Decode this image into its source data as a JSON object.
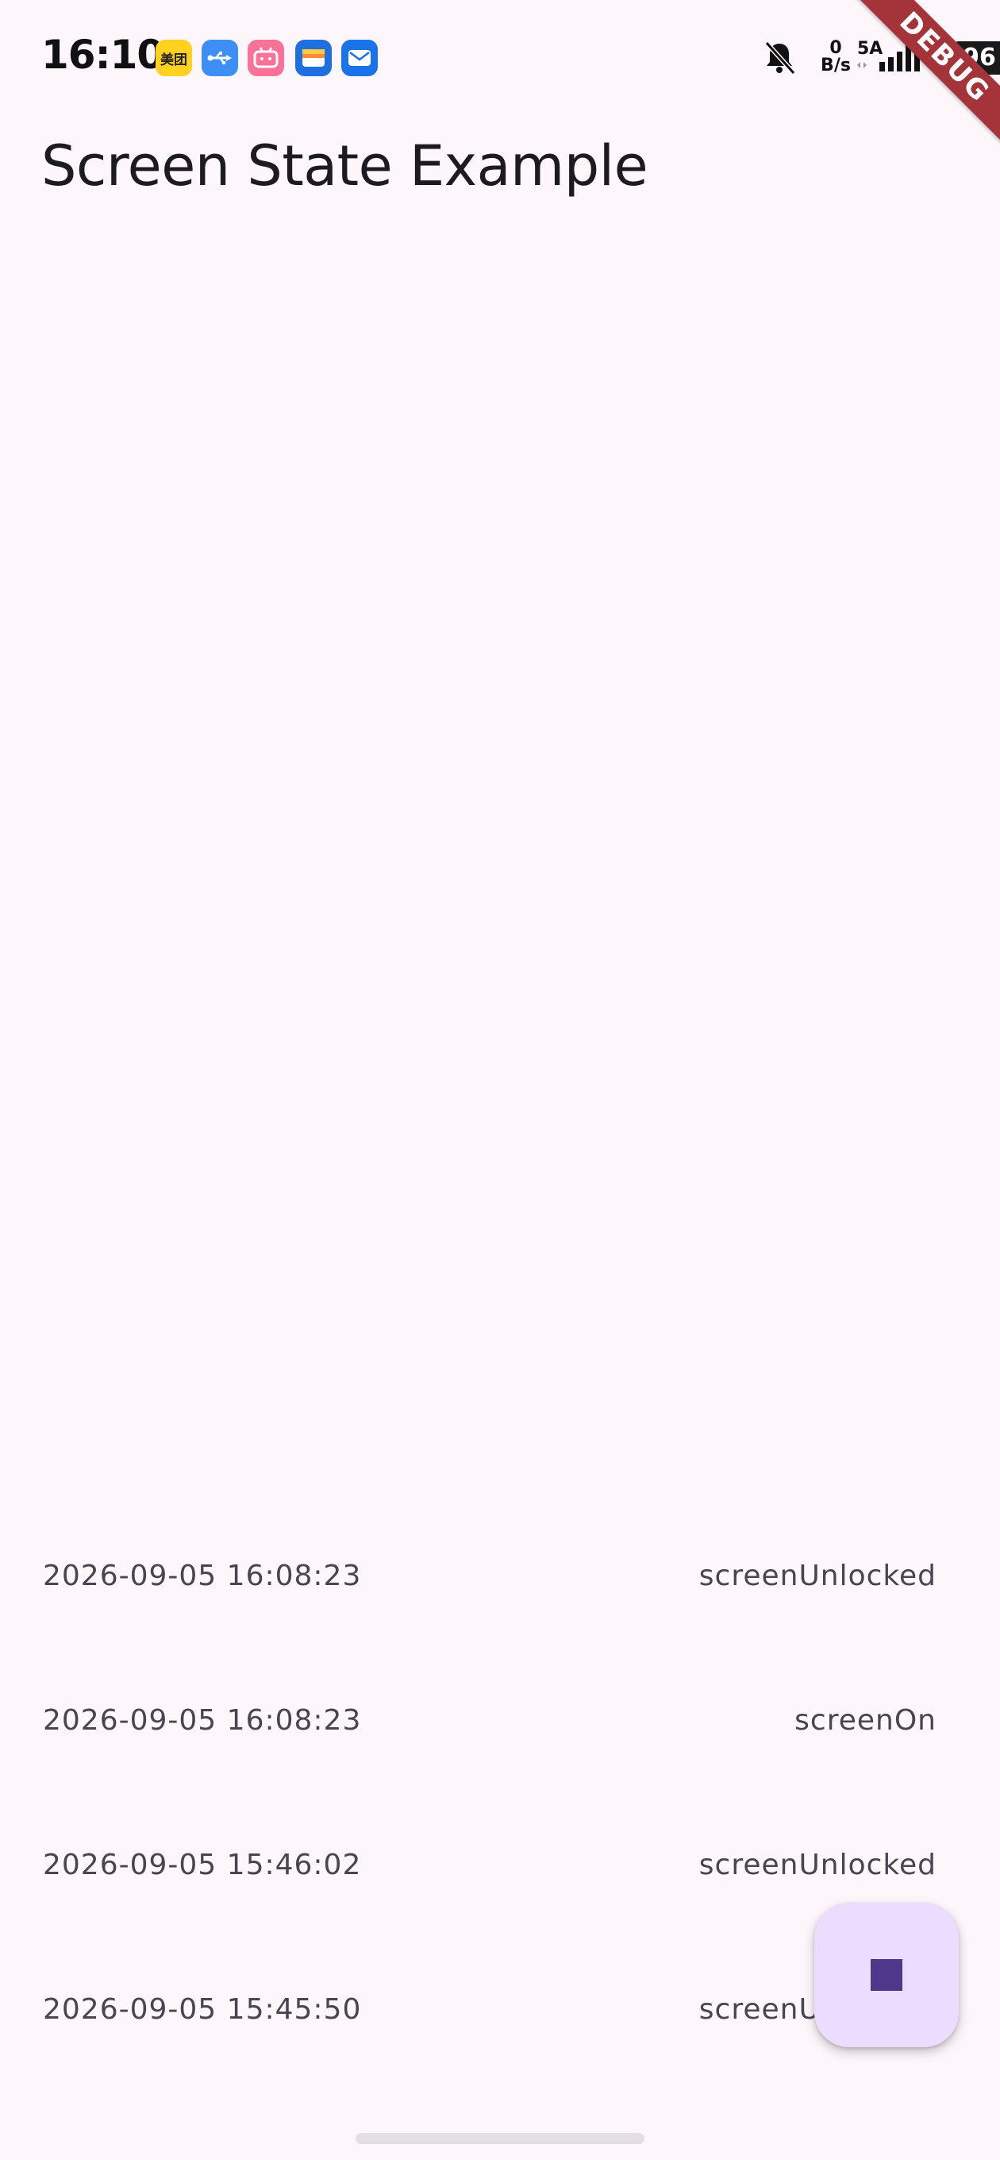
{
  "status_bar": {
    "time": "16:10",
    "app_icons": [
      "meituan-icon",
      "usb-icon",
      "bilibili-icon",
      "wallet-icon",
      "mail-icon"
    ],
    "meituan_text": "美团",
    "net_speed_value": "0",
    "net_speed_unit": "B/s",
    "network_type": "5A",
    "battery": "96"
  },
  "debug_banner": "DEBUG",
  "app_bar": {
    "title": "Screen State Example"
  },
  "events": [
    {
      "time": "2026-09-05 16:08:23",
      "name": "screenUnlocked"
    },
    {
      "time": "2026-09-05 16:08:23",
      "name": "screenOn"
    },
    {
      "time": "2026-09-05 15:46:02",
      "name": "screenUnlocked"
    },
    {
      "time": "2026-09-05 15:45:50",
      "name": "screenUnlocked"
    }
  ],
  "fab": {
    "icon": "stop-icon"
  },
  "colors": {
    "background": "#fdf7fc",
    "fab_background": "#eaddff",
    "fab_icon": "#4f378b",
    "debug_banner": "#a4343a"
  }
}
